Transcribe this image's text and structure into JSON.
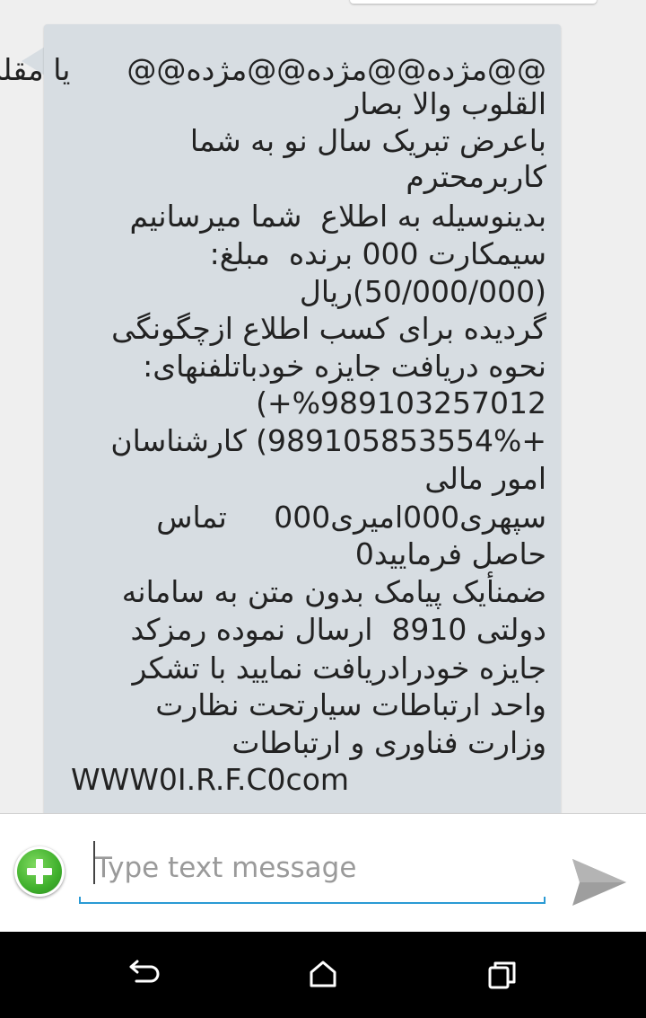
{
  "message": {
    "lines": [
      "@@مژده@@مژده@@مژده@@      یا مقلب",
      "القلوب والا بصار",
      "باعرض تبریک سال نو به شما",
      "کاربرمحترم",
      "بدینوسیله به اطلاع  شما میرسانیم",
      "سیمکارت 000 برنده  مبلغ:",
      "(50/000/000)ریال",
      "گردیده برای کسب اطلاع ازچگونگی",
      "نحوه دریافت جایزه خودباتلفنهای:",
      "(+%989103257012",
      "+989105853554%) کارشناسان",
      "امور مالی",
      "سپهری000امیری000     تماس",
      "حاصل فرمایید0",
      "ضمنأیک پیامک بدون متن به سامانه",
      "دولتی 8910  ارسال نموده رمزکد",
      "جایزه خودرادریافت نمایید با تشکر",
      "واحد ارتباطات سیارتحت نظارت",
      "وزارت فناوری و ارتباطات",
      "WWW0I.R.F.C0com"
    ]
  },
  "compose": {
    "placeholder": "Type text message",
    "add_icon": "add-attachment-icon",
    "send_icon": "send-icon"
  },
  "nav": {
    "back_icon": "back-icon",
    "home_icon": "home-icon",
    "recent_icon": "recent-apps-icon"
  },
  "colors": {
    "bubble": "#d7dde2",
    "accent": "#2a9ad4",
    "add_green": "#3fb02c",
    "send_gray": "#9e9e9e"
  }
}
